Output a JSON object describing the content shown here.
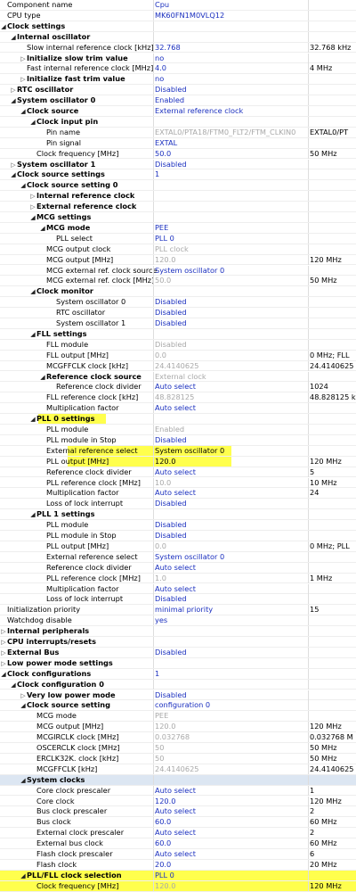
{
  "colors": {
    "highlight": "#ffff4d",
    "value_blue": "#1a2fbf",
    "value_gray": "#a8a8a8"
  },
  "rows": [
    {
      "label": "Component name",
      "level": 0,
      "value": "Cpu"
    },
    {
      "label": "CPU type",
      "level": 0,
      "value": "MK60FN1M0VLQ12"
    },
    {
      "label": "Clock settings",
      "level": 0,
      "tw": "e",
      "bold": true
    },
    {
      "label": "Internal oscillator",
      "level": 1,
      "tw": "e",
      "bold": true
    },
    {
      "label": "Slow internal reference clock [kHz]",
      "level": 2,
      "value": "32.768",
      "extra": "32.768 kHz"
    },
    {
      "label": "Initialize slow trim value",
      "level": 2,
      "tw": "c",
      "bold": true,
      "value": "no"
    },
    {
      "label": "Fast internal reference clock [MHz]",
      "level": 2,
      "value": "4.0",
      "extra": "4 MHz"
    },
    {
      "label": "Initialize fast trim value",
      "level": 2,
      "tw": "c",
      "bold": true,
      "value": "no"
    },
    {
      "label": "RTC oscillator",
      "level": 1,
      "tw": "c",
      "bold": true,
      "value": "Disabled"
    },
    {
      "label": "System oscillator 0",
      "level": 1,
      "tw": "e",
      "bold": true,
      "value": "Enabled"
    },
    {
      "label": "Clock source",
      "level": 2,
      "tw": "e",
      "bold": true,
      "value": "External reference clock"
    },
    {
      "label": "Clock input pin",
      "level": 3,
      "tw": "e",
      "bold": true
    },
    {
      "label": "Pin name",
      "level": 4,
      "value": "EXTAL0/PTA18/FTM0_FLT2/FTM_CLKIN0",
      "dis": true,
      "extra": "EXTAL0/PT"
    },
    {
      "label": "Pin signal",
      "level": 4,
      "value": "EXTAL"
    },
    {
      "label": "Clock frequency [MHz]",
      "level": 3,
      "value": "50.0",
      "extra": "50 MHz"
    },
    {
      "label": "System oscillator 1",
      "level": 1,
      "tw": "c",
      "bold": true,
      "value": "Disabled"
    },
    {
      "label": "Clock source settings",
      "level": 1,
      "tw": "e",
      "bold": true,
      "value": "1"
    },
    {
      "label": "Clock source setting 0",
      "level": 2,
      "tw": "e",
      "bold": true
    },
    {
      "label": "Internal reference clock",
      "level": 3,
      "tw": "c",
      "bold": true
    },
    {
      "label": "External reference clock",
      "level": 3,
      "tw": "c",
      "bold": true
    },
    {
      "label": "MCG settings",
      "level": 3,
      "tw": "e",
      "bold": true
    },
    {
      "label": "MCG mode",
      "level": 4,
      "tw": "e",
      "bold": true,
      "value": "PEE"
    },
    {
      "label": "PLL select",
      "level": 5,
      "value": "PLL 0"
    },
    {
      "label": "MCG output clock",
      "level": 4,
      "value": "PLL clock",
      "dis": true
    },
    {
      "label": "MCG output [MHz]",
      "level": 4,
      "value": "120.0",
      "dis": true,
      "extra": "120 MHz"
    },
    {
      "label": "MCG external ref. clock source",
      "level": 4,
      "value": "System oscillator 0"
    },
    {
      "label": "MCG external ref. clock [MHz]",
      "level": 4,
      "value": "50.0",
      "dis": true,
      "extra": "50 MHz"
    },
    {
      "label": "Clock monitor",
      "level": 3,
      "tw": "e",
      "bold": true
    },
    {
      "label": "System oscillator 0",
      "level": 5,
      "value": "Disabled"
    },
    {
      "label": "RTC oscillator",
      "level": 5,
      "value": "Disabled"
    },
    {
      "label": "System oscillator 1",
      "level": 5,
      "value": "Disabled"
    },
    {
      "label": "FLL settings",
      "level": 3,
      "tw": "e",
      "bold": true
    },
    {
      "label": "FLL module",
      "level": 4,
      "value": "Disabled",
      "dis": true
    },
    {
      "label": "FLL output [MHz]",
      "level": 4,
      "value": "0.0",
      "dis": true,
      "extra": "0 MHz; FLL"
    },
    {
      "label": "MCGFFCLK clock [kHz]",
      "level": 4,
      "value": "24.4140625",
      "dis": true,
      "extra": "24.4140625"
    },
    {
      "label": "Reference clock source",
      "level": 4,
      "tw": "e",
      "bold": true,
      "value": "External clock",
      "dis": true
    },
    {
      "label": "Reference clock divider",
      "level": 5,
      "value": "Auto select",
      "extra": "1024"
    },
    {
      "label": "FLL reference clock [kHz]",
      "level": 4,
      "value": "48.828125",
      "dis": true,
      "extra": "48.828125 k"
    },
    {
      "label": "Multiplication factor",
      "level": 4,
      "value": "Auto select"
    },
    {
      "label": "PLL 0 settings",
      "level": 3,
      "tw": "e",
      "bold": true,
      "hl": "label"
    },
    {
      "label": "PLL module",
      "level": 4,
      "value": "Enabled",
      "dis": true
    },
    {
      "label": "PLL module in Stop",
      "level": 4,
      "value": "Disabled"
    },
    {
      "label": "External reference select",
      "level": 4,
      "value": "System oscillator 0",
      "hl": "wide"
    },
    {
      "label": "PLL output [MHz]",
      "level": 4,
      "value": "120.0",
      "extra": "120 MHz",
      "hl": "wide"
    },
    {
      "label": "Reference clock divider",
      "level": 4,
      "value": "Auto select",
      "extra": "5"
    },
    {
      "label": "PLL reference clock [MHz]",
      "level": 4,
      "value": "10.0",
      "dis": true,
      "extra": "10 MHz"
    },
    {
      "label": "Multiplication factor",
      "level": 4,
      "value": "Auto select",
      "extra": "24"
    },
    {
      "label": "Loss of lock interrupt",
      "level": 4,
      "value": "Disabled"
    },
    {
      "label": "PLL 1 settings",
      "level": 3,
      "tw": "e",
      "bold": true
    },
    {
      "label": "PLL module",
      "level": 4,
      "value": "Disabled"
    },
    {
      "label": "PLL module in Stop",
      "level": 4,
      "value": "Disabled"
    },
    {
      "label": "PLL output [MHz]",
      "level": 4,
      "value": "0.0",
      "dis": true,
      "extra": "0 MHz; PLL"
    },
    {
      "label": "External reference select",
      "level": 4,
      "value": "System oscillator 0"
    },
    {
      "label": "Reference clock divider",
      "level": 4,
      "value": "Auto select"
    },
    {
      "label": "PLL reference clock [MHz]",
      "level": 4,
      "value": "1.0",
      "dis": true,
      "extra": "1 MHz"
    },
    {
      "label": "Multiplication factor",
      "level": 4,
      "value": "Auto select"
    },
    {
      "label": "Loss of lock interrupt",
      "level": 4,
      "value": "Disabled"
    },
    {
      "label": "Initialization priority",
      "level": 0,
      "value": "minimal priority",
      "extra": "15"
    },
    {
      "label": "Watchdog disable",
      "level": 0,
      "value": "yes"
    },
    {
      "label": "Internal peripherals",
      "level": 0,
      "tw": "c",
      "bold": true
    },
    {
      "label": "CPU interrupts/resets",
      "level": 0,
      "tw": "c",
      "bold": true
    },
    {
      "label": "External Bus",
      "level": 0,
      "tw": "c",
      "bold": true,
      "value": "Disabled"
    },
    {
      "label": "Low power mode settings",
      "level": 0,
      "tw": "c",
      "bold": true
    },
    {
      "label": "Clock configurations",
      "level": 0,
      "tw": "e",
      "bold": true,
      "value": "1"
    },
    {
      "label": "Clock configuration 0",
      "level": 1,
      "tw": "e",
      "bold": true
    },
    {
      "label": "Very low power mode",
      "level": 2,
      "tw": "c",
      "bold": true,
      "value": "Disabled"
    },
    {
      "label": "Clock source setting",
      "level": 2,
      "tw": "e",
      "bold": true,
      "value": "configuration 0"
    },
    {
      "label": "MCG mode",
      "level": 3,
      "value": "PEE",
      "dis": true
    },
    {
      "label": "MCG output [MHz]",
      "level": 3,
      "value": "120.0",
      "dis": true,
      "extra": "120 MHz"
    },
    {
      "label": "MCGIRCLK clock [MHz]",
      "level": 3,
      "value": "0.032768",
      "dis": true,
      "extra": "0.032768 M"
    },
    {
      "label": "OSCERCLK clock [MHz]",
      "level": 3,
      "value": "50",
      "dis": true,
      "extra": "50 MHz"
    },
    {
      "label": "ERCLK32K. clock [kHz]",
      "level": 3,
      "value": "50",
      "dis": true,
      "extra": "50 MHz"
    },
    {
      "label": "MCGFFCLK [kHz]",
      "level": 3,
      "value": "24.4140625",
      "dis": true,
      "extra": "24.4140625"
    },
    {
      "label": "System clocks",
      "level": 2,
      "tw": "e",
      "bold": true,
      "band": true
    },
    {
      "label": "Core clock prescaler",
      "level": 3,
      "value": "Auto select",
      "extra": "1"
    },
    {
      "label": "Core clock",
      "level": 3,
      "value": "120.0",
      "extra": "120 MHz"
    },
    {
      "label": "Bus clock prescaler",
      "level": 3,
      "value": "Auto select",
      "extra": "2"
    },
    {
      "label": "Bus clock",
      "level": 3,
      "value": "60.0",
      "extra": "60 MHz"
    },
    {
      "label": "External clock prescaler",
      "level": 3,
      "value": "Auto select",
      "extra": "2"
    },
    {
      "label": "External bus clock",
      "level": 3,
      "value": "60.0",
      "extra": "60 MHz"
    },
    {
      "label": "Flash clock prescaler",
      "level": 3,
      "value": "Auto select",
      "extra": "6"
    },
    {
      "label": "Flash clock",
      "level": 3,
      "value": "20.0",
      "extra": "20 MHz"
    },
    {
      "label": "PLL/FLL clock selection",
      "level": 2,
      "tw": "e",
      "bold": true,
      "value": "PLL 0",
      "hl": "full"
    },
    {
      "label": "Clock frequency [MHz]",
      "level": 3,
      "value": "120.0",
      "dis": true,
      "extra": "120 MHz",
      "hl": "full"
    }
  ]
}
